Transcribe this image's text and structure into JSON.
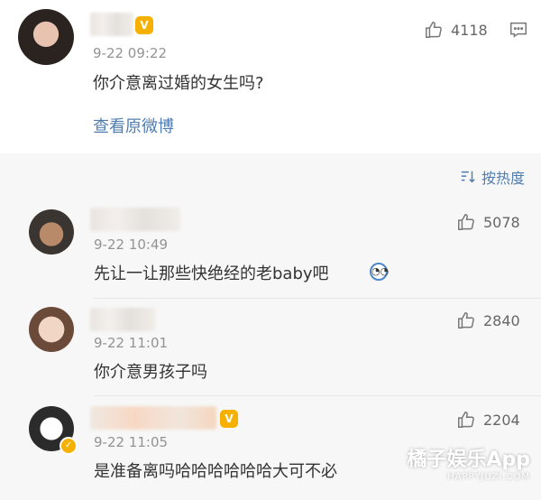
{
  "post": {
    "time": "9-22 09:22",
    "text": "你介意离过婚的女生吗?",
    "view_original": "查看原微博",
    "like_count": "4118"
  },
  "sort": {
    "label": "按热度"
  },
  "comments": [
    {
      "time": "9-22 10:49",
      "text": "先让一让那些快绝经的老baby吧",
      "likes": "5078"
    },
    {
      "time": "9-22 11:01",
      "text": "你介意男孩子吗",
      "likes": "2840"
    },
    {
      "time": "9-22 11:05",
      "text": "是准备离吗哈哈哈哈哈哈大可不必",
      "likes": "2204"
    }
  ],
  "watermark": {
    "title": "橘子娱乐App",
    "sub": "HAPPYJUZI.COM"
  },
  "colors": {
    "link": "#507daf",
    "vip": "#f6b100",
    "background": "#f7f7f7"
  }
}
